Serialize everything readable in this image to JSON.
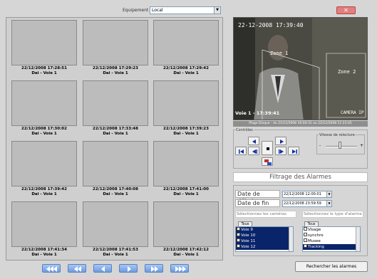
{
  "header": {
    "equipment_label": "Equipement",
    "equipment_value": "Local",
    "close_label": "✕"
  },
  "grid": {
    "tiles": [
      {
        "time": "22/12/2008  17:28:51",
        "channel": "Dai - Voie 1"
      },
      {
        "time": "22/12/2008  17:29:23",
        "channel": "Dai - Voie 1"
      },
      {
        "time": "22/12/2008  17:29:42",
        "channel": "Dai - Voie 1"
      },
      {
        "time": "22/12/2008  17:30:02",
        "channel": "Dai - Voie 1"
      },
      {
        "time": "22/12/2008  17:33:48",
        "channel": "Dai - Voie 1"
      },
      {
        "time": "22/12/2008  17:39:23",
        "channel": "Dai - Voie 1"
      },
      {
        "time": "22/12/2008  17:39:42",
        "channel": "Dai - Voie 1"
      },
      {
        "time": "22/12/2008  17:40:08",
        "channel": "Dai - Voie 1"
      },
      {
        "time": "22/12/2008  17:41:00",
        "channel": "Dai - Voie 1"
      },
      {
        "time": "22/12/2008  17:41:34",
        "channel": "Dai - Voie 1"
      },
      {
        "time": "22/12/2008  17:41:53",
        "channel": "Dai - Voie 1"
      },
      {
        "time": "22/12/2008  17:42:12",
        "channel": "Dai - Voie 1"
      }
    ]
  },
  "video": {
    "overlay_timestamp": "22-12-2008 17:39:40",
    "zone1": "Zone 1",
    "zone2": "Zone 2",
    "channel_time": "Voie 1 - 17:39:41",
    "camera_tag": "CAMERA IP",
    "range": "Plage Disque : du 21/12/2008 16:04:31 au 22/12/2008 11:23:45"
  },
  "controls": {
    "title": "Contrôles",
    "speed_title": "Vitesse de relecture",
    "speed_minus": "-",
    "speed_plus": "+"
  },
  "filter": {
    "title": "Filtrage des Alarmes",
    "start_label": "Date de début",
    "start_value": "22/12/2008 12:00:01",
    "end_label": "Date de fin",
    "end_value": "22/12/2008 23:59:59",
    "cameras_label": "Sélectionnez les caméras",
    "alarm_type_label": "Sélectionnez le type d'alarme",
    "all_label": "Tous",
    "cameras": [
      "Voie 9",
      "Voie 10",
      "Voie 11",
      "Voie 12"
    ],
    "alarm_types": [
      "Visage",
      "synchro",
      "Musee",
      "Tracking"
    ],
    "search_label": "Rechercher les alarmes"
  }
}
